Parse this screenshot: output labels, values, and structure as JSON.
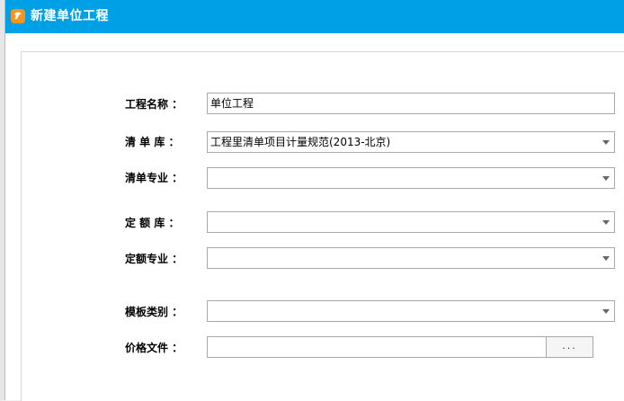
{
  "window": {
    "title": "新建单位工程"
  },
  "form": {
    "project_name": {
      "label": "工程名称 ：",
      "value": "单位工程"
    },
    "bill_library": {
      "label": "清 单 库 ：",
      "value": "工程里清单项目计量规范(2013-北京)"
    },
    "bill_specialty": {
      "label": "清单专业 ：",
      "value": ""
    },
    "quota_library": {
      "label": "定 额 库 ：",
      "value": ""
    },
    "quota_specialty": {
      "label": "定额专业 ：",
      "value": ""
    },
    "template_category": {
      "label": "模板类别 ：",
      "value": ""
    },
    "price_file": {
      "label": "价格文件 ：",
      "value": "",
      "browse_label": "..."
    }
  },
  "colors": {
    "titlebar": "#00a0e6",
    "app_icon": "#f7941d"
  },
  "icons": {
    "app": "app-logo-icon",
    "dropdown": "chevron-down-icon"
  }
}
